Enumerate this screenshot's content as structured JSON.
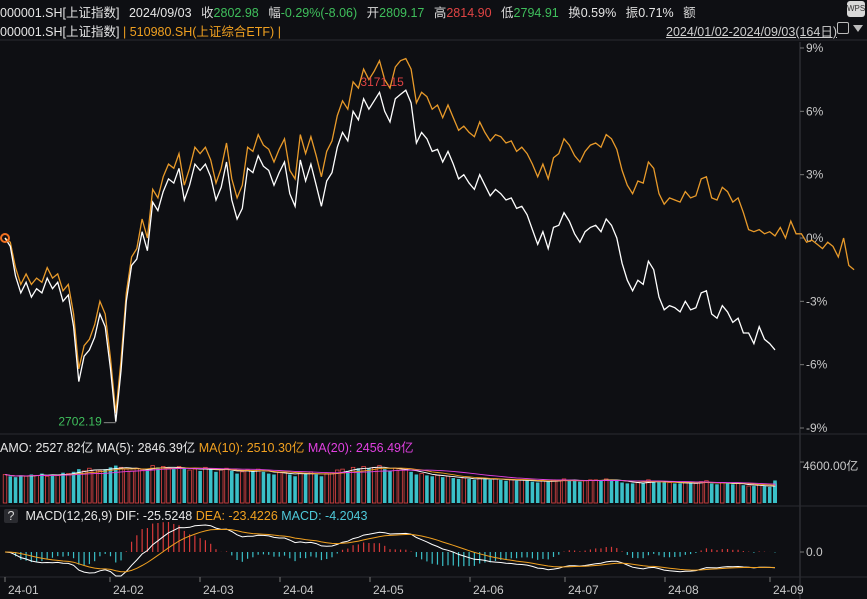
{
  "header": {
    "symbol": "000001.SH[上证指数]",
    "date": "2024/09/03",
    "close_label": "收",
    "close_value": "2802.98",
    "change_label": "幅",
    "change_value": "-0.29%(-8.06)",
    "open_label": "开",
    "open_value": "2809.17",
    "high_label": "高",
    "high_value": "2814.90",
    "low_label": "低",
    "low_value": "2794.91",
    "turnover_label": "换",
    "turnover_value": "0.59%",
    "amplitude_label": "振",
    "amplitude_value": "0.71%",
    "amount_label": "额"
  },
  "compare": {
    "main": "000001.SH[上证指数]",
    "sep": "|",
    "etf": "510980.SH(上证综合ETF)",
    "sep2": "|",
    "range": "2024/01/02-2024/09/03(164日)"
  },
  "icons": {
    "wps": "WPS",
    "close": "close-icon",
    "dropdown": "triangle-down-icon"
  },
  "colors": {
    "index": "#ffffff",
    "etf": "#e89a2a",
    "up": "#e04444",
    "down": "#3fbf5c",
    "macd_pos": "#d83a3a",
    "macd_neg": "#3ac0c8"
  },
  "amo_bar": {
    "amo_label": "AMO:",
    "amo_value": "2527.82亿",
    "ma5_label": "MA(5):",
    "ma5_value": "2846.39亿",
    "ma10_label": "MA(10):",
    "ma10_value": "2510.30亿",
    "ma20_label": "MA(20):",
    "ma20_value": "2456.49亿",
    "axis_label": "4600.00亿"
  },
  "macd_bar": {
    "help": "?",
    "title": "MACD(12,26,9)",
    "dif_label": "DIF:",
    "dif_value": "-25.5248",
    "dea_label": "DEA:",
    "dea_value": "-23.4226",
    "macd_label": "MACD:",
    "macd_value": "-4.2043",
    "axis_label": "0.0"
  },
  "chart_data": {
    "type": "line",
    "yticks": [
      "9%",
      "6%",
      "3%",
      "0%",
      "-3%",
      "-6%",
      "-9%"
    ],
    "ylim": [
      -9,
      9
    ],
    "xticks": [
      "24-01",
      "24-02",
      "24-03",
      "24-04",
      "24-05",
      "24-06",
      "24-07",
      "24-08",
      "24-09"
    ],
    "annotations": [
      {
        "text": "3171.15"
      },
      {
        "text": "2702.19"
      }
    ],
    "series": [
      {
        "name": "000001.SH[上证指数]",
        "values": [
          0,
          -0.4,
          -1.8,
          -2.6,
          -2.1,
          -2.8,
          -2.4,
          -2.6,
          -1.9,
          -2.4,
          -2.1,
          -3.0,
          -2.7,
          -4.2,
          -6.8,
          -5.6,
          -5.3,
          -4.7,
          -3.6,
          -4.2,
          -6.2,
          -8.7,
          -6.3,
          -3.0,
          -1.3,
          -1.0,
          0.3,
          -0.6,
          1.7,
          1.3,
          2.2,
          2.8,
          2.6,
          3.3,
          1.8,
          2.5,
          3.5,
          3.2,
          3.5,
          2.9,
          1.8,
          2.4,
          3.6,
          1.8,
          0.9,
          1.4,
          3.3,
          3.1,
          3.9,
          3.4,
          3.2,
          2.5,
          3.1,
          3.6,
          2.1,
          1.5,
          3.7,
          2.7,
          3.5,
          2.5,
          1.5,
          2.7,
          3.1,
          4.3,
          5.0,
          4.6,
          6.0,
          5.6,
          6.6,
          6.1,
          6.5,
          6.9,
          6.0,
          5.5,
          6.6,
          6.8,
          7.0,
          6.4,
          4.5,
          5.0,
          4.7,
          4.1,
          4.2,
          3.6,
          4.1,
          3.5,
          2.8,
          3.0,
          2.6,
          2.3,
          3.0,
          2.5,
          2.0,
          2.3,
          2.1,
          1.8,
          1.9,
          1.4,
          1.5,
          1.1,
          0.4,
          -0.3,
          0.3,
          -0.5,
          0.5,
          0.6,
          1.2,
          0.8,
          0.2,
          -0.2,
          0.3,
          0.5,
          0.6,
          0.3,
          0.9,
          0.6,
          0.0,
          -1.2,
          -2.0,
          -2.5,
          -2.0,
          -2.2,
          -1.1,
          -1.5,
          -2.8,
          -3.4,
          -3.2,
          -3.3,
          -3.5,
          -3.0,
          -3.4,
          -3.3,
          -2.6,
          -2.5,
          -3.6,
          -3.8,
          -3.2,
          -3.5,
          -4.0,
          -3.8,
          -4.5,
          -4.5,
          -5.0,
          -4.2,
          -4.8,
          -5.0,
          -5.3
        ]
      },
      {
        "name": "510980.SH(上证综合ETF)",
        "values": [
          0,
          -0.2,
          -1.4,
          -2.2,
          -1.7,
          -2.2,
          -1.9,
          -2.1,
          -1.4,
          -1.9,
          -1.7,
          -2.5,
          -2.2,
          -3.6,
          -6.2,
          -5.1,
          -4.8,
          -4.1,
          -3.0,
          -3.6,
          -5.7,
          -8.3,
          -5.8,
          -2.6,
          -0.9,
          -0.5,
          0.9,
          0.0,
          2.3,
          1.9,
          2.9,
          3.5,
          3.3,
          4.0,
          2.5,
          3.3,
          4.3,
          4.0,
          4.3,
          3.7,
          2.6,
          3.3,
          4.5,
          2.8,
          1.9,
          2.5,
          4.3,
          4.1,
          4.9,
          4.4,
          4.2,
          3.6,
          4.2,
          4.7,
          3.2,
          2.8,
          4.9,
          4.0,
          4.8,
          3.9,
          2.9,
          4.1,
          4.6,
          5.8,
          6.5,
          6.1,
          7.4,
          7.1,
          8.0,
          7.5,
          7.9,
          8.4,
          7.5,
          7.1,
          8.1,
          8.4,
          8.5,
          8.0,
          6.4,
          6.9,
          6.7,
          6.1,
          6.3,
          5.7,
          6.3,
          5.7,
          5.1,
          5.3,
          5.0,
          4.8,
          5.5,
          5.0,
          4.6,
          4.9,
          4.8,
          4.5,
          4.6,
          4.1,
          4.3,
          4.0,
          3.5,
          2.9,
          3.5,
          2.8,
          3.8,
          4.0,
          4.7,
          4.4,
          3.9,
          3.6,
          4.1,
          4.4,
          4.5,
          4.3,
          4.9,
          4.7,
          4.2,
          3.2,
          2.5,
          2.1,
          2.7,
          2.6,
          3.6,
          3.3,
          2.1,
          1.6,
          1.9,
          1.8,
          1.7,
          2.2,
          1.9,
          2.0,
          2.8,
          2.9,
          1.9,
          1.8,
          2.4,
          2.2,
          1.7,
          1.9,
          1.2,
          0.4,
          0.3,
          0.4,
          0.2,
          0.3,
          0.1,
          0.5,
          0.0,
          0.8,
          0.2,
          0.2,
          -0.2,
          -0.1,
          -0.3,
          -0.5,
          -0.2,
          -0.4,
          -0.9,
          0.0,
          -1.3,
          -1.5
        ]
      }
    ],
    "volume": {
      "unit": "亿",
      "ylim": [
        0,
        4600
      ],
      "values": [
        3200,
        3000,
        2900,
        3100,
        3000,
        3200,
        3100,
        3300,
        3000,
        3200,
        3100,
        3400,
        3300,
        3500,
        3800,
        3600,
        3900,
        3700,
        3600,
        3800,
        4000,
        4200,
        4000,
        3800,
        3600,
        3900,
        3700,
        3800,
        4200,
        4000,
        4100,
        3900,
        3800,
        4100,
        3900,
        3700,
        3800,
        3600,
        4000,
        3800,
        3500,
        3700,
        3900,
        3600,
        3300,
        3500,
        3700,
        3600,
        3800,
        3500,
        3300,
        3200,
        3400,
        3500,
        3200,
        3000,
        3400,
        3300,
        3500,
        3200,
        3000,
        3300,
        3400,
        3700,
        3800,
        3600,
        4000,
        3900,
        4100,
        3900,
        4000,
        4200,
        3800,
        3600,
        3900,
        3700,
        3800,
        3500,
        3200,
        3300,
        3100,
        3000,
        3100,
        2900,
        3000,
        2800,
        2700,
        2800,
        2700,
        2600,
        2800,
        2700,
        2600,
        2700,
        2600,
        2500,
        2600,
        2500,
        2600,
        2500,
        2400,
        2300,
        2500,
        2400,
        2600,
        2500,
        2700,
        2600,
        2500,
        2400,
        2500,
        2600,
        2600,
        2500,
        2700,
        2600,
        2500,
        2300,
        2200,
        2200,
        2300,
        2200,
        2600,
        2500,
        2400,
        2300,
        2300,
        2200,
        2200,
        2300,
        2200,
        2200,
        2400,
        2500,
        2200,
        2100,
        2300,
        2200,
        2100,
        2200,
        2000,
        1900,
        1900,
        2000,
        1900,
        1800,
        1900,
        2000,
        1900,
        2100,
        2000,
        1900,
        1900,
        2000,
        1900,
        1800,
        1900,
        1800,
        1900,
        2100,
        1800,
        2300,
        2527.82
      ]
    },
    "macd": {
      "axis_value": 0.0,
      "last": {
        "dif": -25.5248,
        "dea": -23.4226,
        "macd": -4.2043
      }
    }
  }
}
